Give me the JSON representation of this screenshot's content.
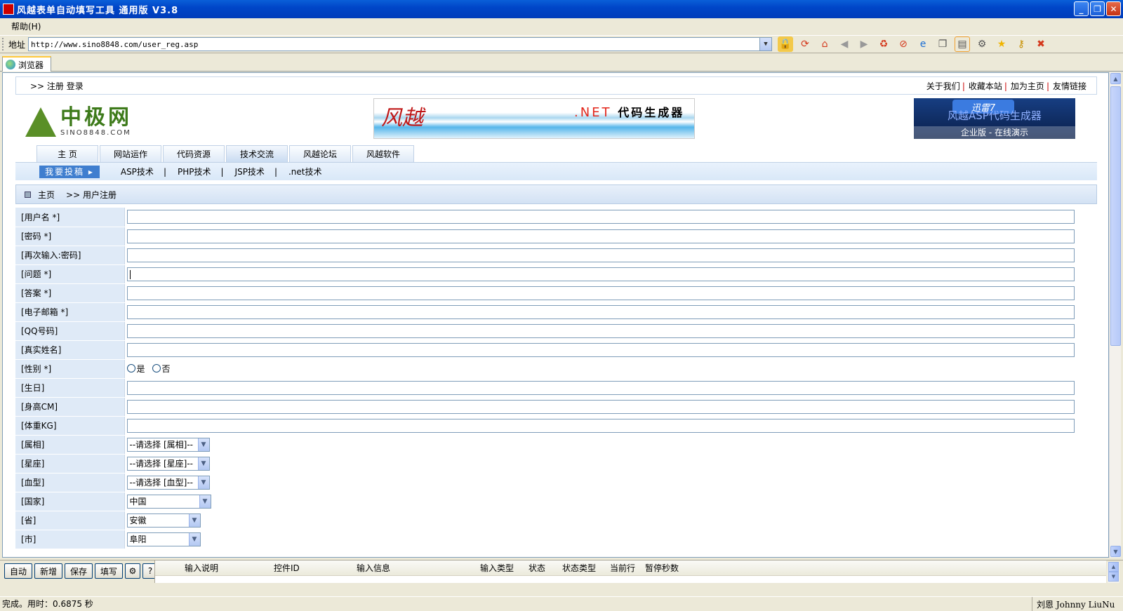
{
  "window": {
    "title": "风越表单自动填写工具 通用版 V3.8",
    "buttons": {
      "minimize": "_",
      "restore": "❐",
      "close": "✕"
    }
  },
  "menu": {
    "items": [
      "帮助(H)"
    ]
  },
  "address": {
    "label": "地址",
    "url": "http://www.sino8848.com/user_reg.asp"
  },
  "toolbar": {
    "icons": [
      "lock-icon",
      "refresh-icon",
      "home-icon",
      "back-icon",
      "forward-icon",
      "recycle-icon",
      "stop-icon",
      "ie-icon",
      "copy-icon",
      "window-icon",
      "tools-icon",
      "star-icon",
      "key-icon",
      "close-icon"
    ]
  },
  "tab": {
    "label": "浏览器"
  },
  "site": {
    "top_left": ">> 注册  登录",
    "top_links": [
      "关于我们",
      "收藏本站",
      "加为主页",
      "友情链接"
    ],
    "logo_big": "中极网",
    "logo_small": "SINO8848.COM",
    "banner_net": ".NET",
    "banner_gen": "代码生成器",
    "right_banner_badge": "迅雷7",
    "right_banner_top": "风越ASP代码生成器",
    "right_banner_bottom": "企业版 - 在线演示",
    "nav_tabs": [
      "主 页",
      "网站运作",
      "代码资源",
      "技术交流",
      "风越论坛",
      "风越软件"
    ],
    "submit_label": "我要投稿",
    "sub_links": [
      "ASP技术",
      "PHP技术",
      "JSP技术",
      ".net技术"
    ],
    "crumb_home": "主页",
    "crumb_current": ">> 用户注册"
  },
  "form": {
    "rows": [
      {
        "label": "[用户名 *]",
        "type": "text"
      },
      {
        "label": "[密码 *]",
        "type": "text"
      },
      {
        "label": "[再次输入:密码]",
        "type": "text"
      },
      {
        "label": "[问题 *]",
        "type": "text",
        "focused": true
      },
      {
        "label": "[答案 *]",
        "type": "text"
      },
      {
        "label": "[电子邮箱 *]",
        "type": "text"
      },
      {
        "label": "[QQ号码]",
        "type": "text"
      },
      {
        "label": "[真实姓名]",
        "type": "text"
      },
      {
        "label": "[性别 *]",
        "type": "radio",
        "options": [
          "是",
          "否"
        ]
      },
      {
        "label": "[生日]",
        "type": "text"
      },
      {
        "label": "[身高CM]",
        "type": "text"
      },
      {
        "label": "[体重KG]",
        "type": "text"
      },
      {
        "label": "[属相]",
        "type": "select",
        "value": "--请选择 [属相]--"
      },
      {
        "label": "[星座]",
        "type": "select",
        "value": "--请选择 [星座]--"
      },
      {
        "label": "[血型]",
        "type": "select",
        "value": "--请选择 [血型]--"
      },
      {
        "label": "[国家]",
        "type": "select",
        "value": "中国"
      },
      {
        "label": "[省]",
        "type": "select",
        "value": "安徽"
      },
      {
        "label": "[市]",
        "type": "select",
        "value": "阜阳"
      }
    ]
  },
  "bottom": {
    "buttons": [
      "自动",
      "新增",
      "保存",
      "填写"
    ],
    "gear_icon": "gear-icon",
    "help_label": "?",
    "columns": [
      "输入说明",
      "控件ID",
      "输入信息",
      "输入类型",
      "状态",
      "状态类型",
      "当前行",
      "暂停秒数"
    ]
  },
  "status": {
    "left": "完成。用时：0.6875 秒",
    "right": "刘恩 Johnny LiuNu"
  }
}
